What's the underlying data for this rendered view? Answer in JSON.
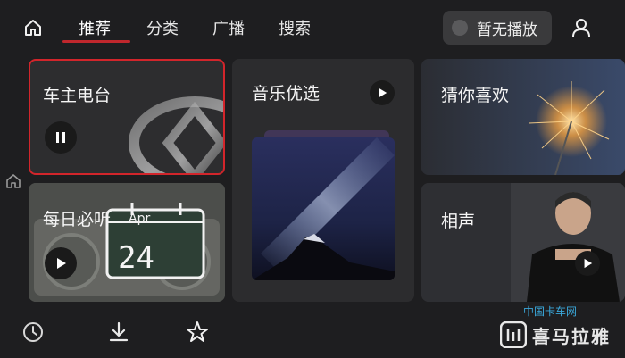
{
  "header": {
    "tabs": [
      {
        "label": "推荐",
        "active": true
      },
      {
        "label": "分类",
        "active": false
      },
      {
        "label": "广播",
        "active": false
      },
      {
        "label": "搜索",
        "active": false
      }
    ],
    "now_playing": "暂无播放"
  },
  "cards": {
    "car_owner_radio": {
      "title": "车主电台",
      "state": "paused"
    },
    "daily_listen": {
      "title": "每日必听",
      "calendar_month": "Apr",
      "calendar_day": "24"
    },
    "music_picks": {
      "title": "音乐优选"
    },
    "guess_you_like": {
      "title": "猜你喜欢"
    },
    "crosstalk": {
      "title": "相声"
    }
  },
  "branding": {
    "logo_text": "喜马拉雅",
    "watermark": "中国卡车网"
  },
  "colors": {
    "accent": "#c0272d",
    "background": "#1e1e20",
    "card": "#2b2b2d"
  },
  "icons": {
    "top_left": "home-icon",
    "top_right": "user-icon",
    "bottom": [
      "history-icon",
      "download-icon",
      "star-icon"
    ]
  }
}
